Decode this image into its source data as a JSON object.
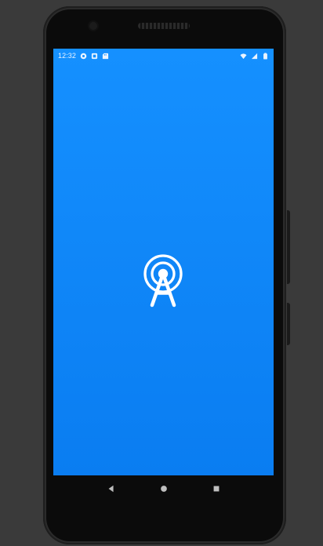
{
  "status_bar": {
    "time": "12:32",
    "left_icons": [
      "recording-icon",
      "notification-icon",
      "sd-card-icon"
    ],
    "right_icons": [
      "wifi-icon",
      "signal-icon",
      "battery-icon"
    ]
  },
  "splash": {
    "icon": "broadcast-tower-icon"
  },
  "navigation": {
    "buttons": [
      "back-icon",
      "home-icon",
      "recents-icon"
    ]
  },
  "colors": {
    "screen_top": "#1590ff",
    "screen_bottom": "#0a7df1",
    "icon": "#ffffff",
    "phone_frame": "#0b0b0b",
    "background": "#3a3a3a",
    "nav_icons": "#bfbfbf"
  }
}
